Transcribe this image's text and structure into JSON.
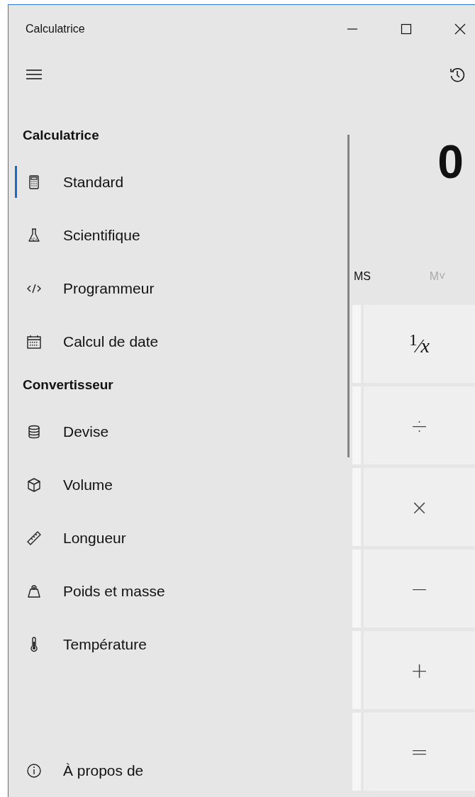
{
  "window": {
    "title": "Calculatrice"
  },
  "navigation": {
    "sections": [
      {
        "heading": "Calculatrice",
        "items": [
          {
            "label": "Standard",
            "selected": true
          },
          {
            "label": "Scientifique",
            "selected": false
          },
          {
            "label": "Programmeur",
            "selected": false
          },
          {
            "label": "Calcul de date",
            "selected": false
          }
        ]
      },
      {
        "heading": "Convertisseur",
        "items": [
          {
            "label": "Devise",
            "selected": false
          },
          {
            "label": "Volume",
            "selected": false
          },
          {
            "label": "Longueur",
            "selected": false
          },
          {
            "label": "Poids et masse",
            "selected": false
          },
          {
            "label": "Température",
            "selected": false
          }
        ]
      }
    ],
    "footer": {
      "label": "À propos de",
      "selected": false
    }
  },
  "display": {
    "value": "0"
  },
  "memory": [
    {
      "label": "MS",
      "disabled": false
    },
    {
      "label": "M˅",
      "disabled": true
    }
  ],
  "keys": [
    {
      "label": "$^{1}$⁄*x*",
      "kind": "function"
    },
    {
      "label": "÷",
      "kind": "operator"
    },
    {
      "label": "×",
      "kind": "operator"
    },
    {
      "label": "−",
      "kind": "operator"
    },
    {
      "label": "+",
      "kind": "operator"
    },
    {
      "label": "=",
      "kind": "equals"
    }
  ]
}
